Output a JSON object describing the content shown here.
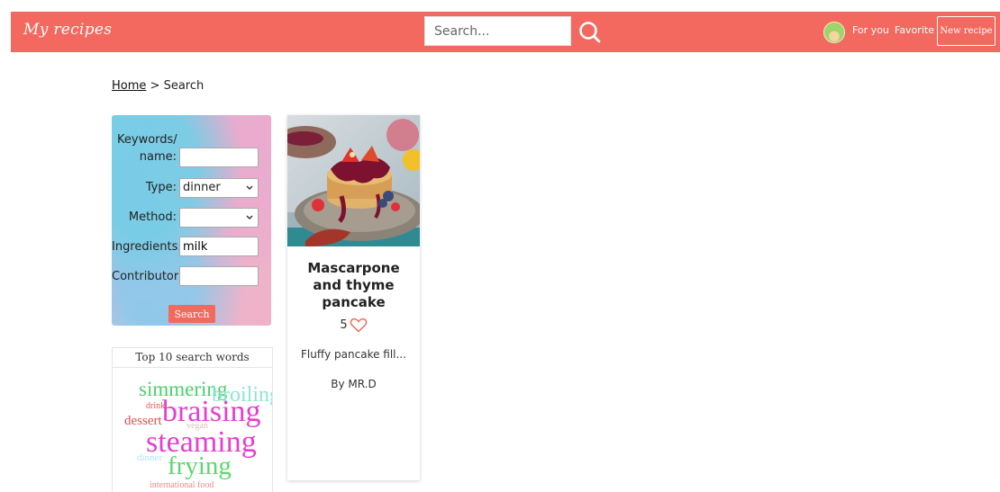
{
  "header": {
    "brand": "My recipes",
    "search_placeholder": "Search...",
    "nav": {
      "for_you": "For you",
      "favorite": "Favorite",
      "new_recipe": "New recipe"
    }
  },
  "breadcrumb": {
    "home": "Home",
    "separator": ">",
    "current": "Search"
  },
  "filters": {
    "keywords_label_1": "Keywords/",
    "keywords_label_2": "name:",
    "keywords_value": "",
    "type_label": "Type:",
    "type_value": "dinner",
    "method_label": "Method:",
    "method_value": "",
    "ingredients_label": "Ingredients:",
    "ingredients_value": "milk",
    "contributor_label": "Contributor:",
    "contributor_value": "",
    "search_label": "Search"
  },
  "word_cloud": {
    "title": "Top 10 search words",
    "words": [
      {
        "text": "simmering",
        "color": "#4fce6a"
      },
      {
        "text": "broiling",
        "color": "#8fe7cf"
      },
      {
        "text": "drink",
        "color": "#e35a5a"
      },
      {
        "text": "braising",
        "color": "#e33fd0"
      },
      {
        "text": "dessert",
        "color": "#e05050"
      },
      {
        "text": "vegan",
        "color": "#d9c0b0"
      },
      {
        "text": "steaming",
        "color": "#e33fd0"
      },
      {
        "text": "dinner",
        "color": "#b3e3f3"
      },
      {
        "text": "frying",
        "color": "#58d96c"
      },
      {
        "text": "international food",
        "color": "#f08a8a"
      }
    ]
  },
  "recipes": [
    {
      "title": "Mascarpone and thyme pancake",
      "likes": "5",
      "description": "Fluffy pancake fill...",
      "author": "By MR.D"
    }
  ],
  "colors": {
    "accent": "#f4695f",
    "heart": "#f4695f"
  }
}
